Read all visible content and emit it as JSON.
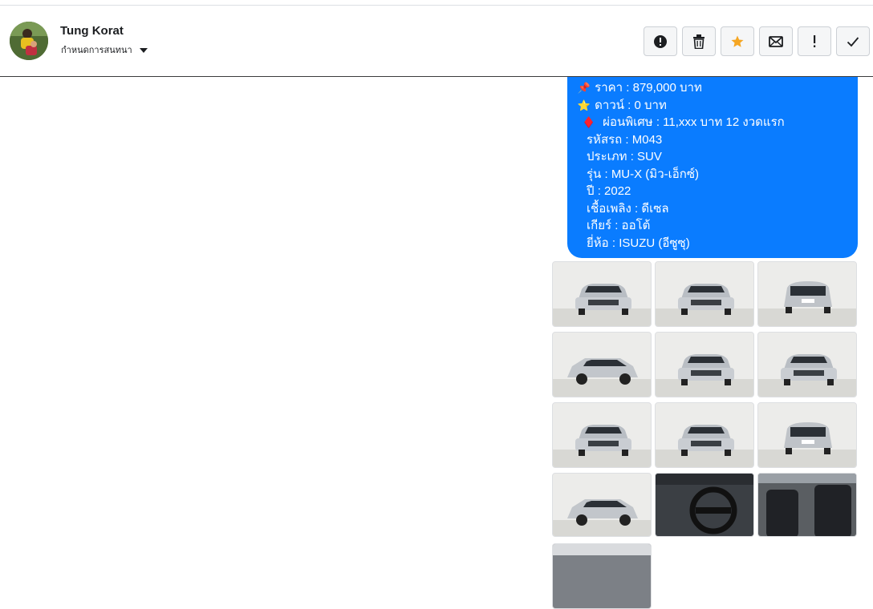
{
  "conversation": {
    "contact_name": "Tung Korat",
    "subtitle": "กำหนดการสนทนา"
  },
  "toolbar": {
    "buttons": [
      {
        "name": "report-button",
        "icon": "alert-circle-icon",
        "glyph": "!"
      },
      {
        "name": "delete-button",
        "icon": "trash-icon"
      },
      {
        "name": "star-button",
        "icon": "star-icon",
        "color": "#f5a623"
      },
      {
        "name": "mark-unread-button",
        "icon": "envelope-icon"
      },
      {
        "name": "important-button",
        "icon": "exclamation-icon",
        "glyph": "!"
      },
      {
        "name": "done-button",
        "icon": "check-icon"
      }
    ]
  },
  "message": {
    "lines": [
      {
        "emoji": "📌",
        "text": "ราคา : 879,000 บาท"
      },
      {
        "emoji": "⭐",
        "text": "ดาวน์ : 0 บาท"
      },
      {
        "emoji": "♦️",
        "text": "ผ่อนพิเศษ : 11,xxx บาท 12 งวดแรก"
      },
      {
        "emoji": "",
        "text": "รหัสรถ : M043"
      },
      {
        "emoji": "",
        "text": "ประเภท : SUV"
      },
      {
        "emoji": "",
        "text": "รุ่น : MU-X (มิว-เอ็กซ์)"
      },
      {
        "emoji": "",
        "text": "ปี : 2022"
      },
      {
        "emoji": "",
        "text": "เชื้อเพลิง : ดีเซล"
      },
      {
        "emoji": "",
        "text": "เกียร์ : ออโต้"
      },
      {
        "emoji": "",
        "text": "ยี่ห้อ : ISUZU (อีซูซุ)"
      }
    ],
    "bubble_color": "#0a7cff"
  },
  "photos": [
    {
      "view": "front-left"
    },
    {
      "view": "front-left"
    },
    {
      "view": "rear"
    },
    {
      "view": "side"
    },
    {
      "view": "front"
    },
    {
      "view": "front"
    },
    {
      "view": "front"
    },
    {
      "view": "front"
    },
    {
      "view": "rear-right"
    },
    {
      "view": "side"
    },
    {
      "view": "steering-wheel"
    },
    {
      "view": "interior-seats"
    },
    {
      "view": "interior-partial"
    }
  ]
}
